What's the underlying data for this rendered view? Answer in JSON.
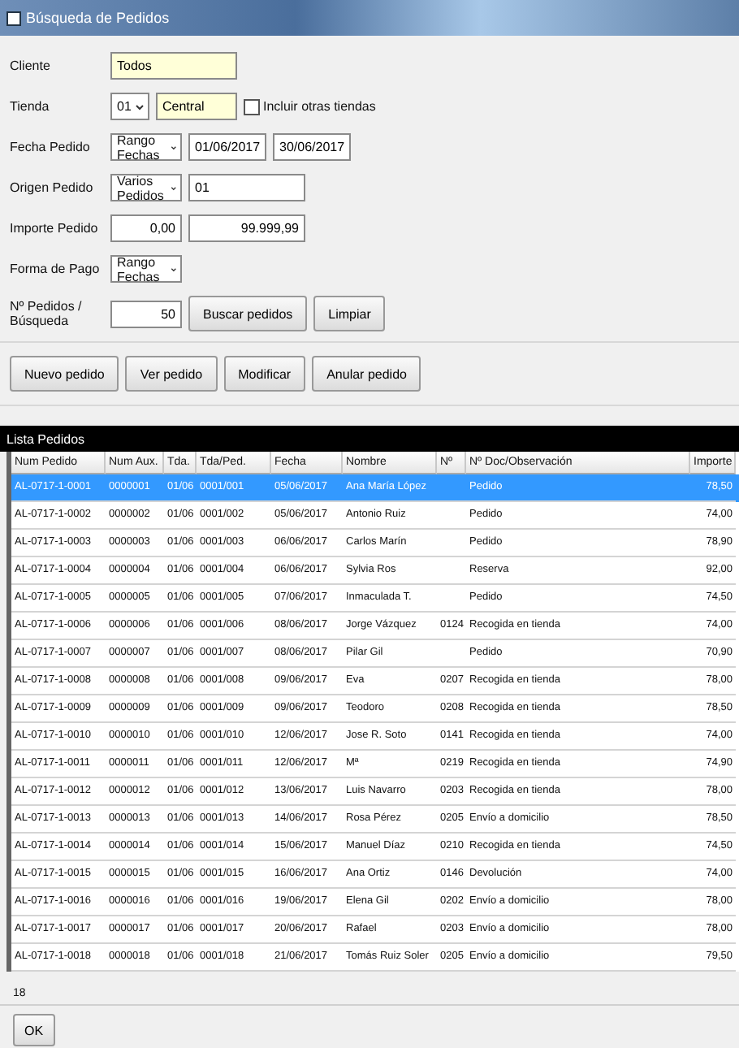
{
  "window": {
    "title": "Búsqueda de Pedidos"
  },
  "form": {
    "client": {
      "label": "Cliente",
      "value": "Todos"
    },
    "store": {
      "label": "Tienda",
      "code": "01",
      "value": "Central",
      "other_stores": {
        "label": "Incluir otras tiendas",
        "checked": false
      }
    },
    "date": {
      "label": "Fecha Pedido",
      "mode": "Rango Fechas",
      "from": "01/06/2017",
      "to": "30/06/2017"
    },
    "origin": {
      "label": "Origen Pedido",
      "mode": "Varios Pedidos",
      "value": "01"
    },
    "amount": {
      "label": "Importe Pedido",
      "from": "0,00",
      "to": "99.999,99"
    },
    "payment": {
      "label": "Forma de Pago",
      "mode": "Rango Fechas"
    },
    "count": {
      "label": "Nº Pedidos / Búsqueda",
      "value": "50"
    },
    "search_button": "Buscar pedidos",
    "clear_button": "Limpiar"
  },
  "actions": [
    "Nuevo pedido",
    "Ver pedido",
    "Modificar",
    "Anular pedido"
  ],
  "list": {
    "title": "Lista Pedidos",
    "columns": [
      "Num Pedido",
      "Num Aux.",
      "Tda.",
      "Tda/Ped.",
      "Fecha",
      "Nombre",
      "Nº",
      "Nº Doc/Observación",
      "Importe"
    ],
    "rows": [
      {
        "selected": true,
        "cells": [
          "AL-0717-1-0001",
          "0000001",
          "01/06",
          "0001/001",
          "05/06/2017",
          "Ana María López",
          "",
          "Pedido",
          "78,50"
        ]
      },
      {
        "selected": false,
        "cells": [
          "AL-0717-1-0002",
          "0000002",
          "01/06",
          "0001/002",
          "05/06/2017",
          "Antonio Ruiz",
          "",
          "Pedido",
          "74,00"
        ]
      },
      {
        "selected": false,
        "cells": [
          "AL-0717-1-0003",
          "0000003",
          "01/06",
          "0001/003",
          "06/06/2017",
          "Carlos Marín",
          "",
          "Pedido",
          "78,90"
        ]
      },
      {
        "selected": false,
        "cells": [
          "AL-0717-1-0004",
          "0000004",
          "01/06",
          "0001/004",
          "06/06/2017",
          "Sylvia Ros",
          "",
          "Reserva",
          "92,00"
        ]
      },
      {
        "selected": false,
        "cells": [
          "AL-0717-1-0005",
          "0000005",
          "01/06",
          "0001/005",
          "07/06/2017",
          "Inmaculada T.",
          "",
          "Pedido",
          "74,50"
        ]
      },
      {
        "selected": false,
        "cells": [
          "AL-0717-1-0006",
          "0000006",
          "01/06",
          "0001/006",
          "08/06/2017",
          "Jorge Vázquez",
          "0124",
          "Recogida en tienda",
          "74,00"
        ]
      },
      {
        "selected": false,
        "cells": [
          "AL-0717-1-0007",
          "0000007",
          "01/06",
          "0001/007",
          "08/06/2017",
          "Pilar Gil",
          "",
          "Pedido",
          "70,90"
        ]
      },
      {
        "selected": false,
        "cells": [
          "AL-0717-1-0008",
          "0000008",
          "01/06",
          "0001/008",
          "09/06/2017",
          "Eva",
          "0207",
          "Recogida en tienda",
          "78,00"
        ]
      },
      {
        "selected": false,
        "cells": [
          "AL-0717-1-0009",
          "0000009",
          "01/06",
          "0001/009",
          "09/06/2017",
          "Teodoro",
          "0208",
          "Recogida en tienda",
          "78,50"
        ]
      },
      {
        "selected": false,
        "cells": [
          "AL-0717-1-0010",
          "0000010",
          "01/06",
          "0001/010",
          "12/06/2017",
          "Jose R. Soto",
          "0141",
          "Recogida en tienda",
          "74,00"
        ]
      },
      {
        "selected": false,
        "cells": [
          "AL-0717-1-0011",
          "0000011",
          "01/06",
          "0001/011",
          "12/06/2017",
          "Mª",
          "0219",
          "Recogida en tienda",
          "74,90"
        ]
      },
      {
        "selected": false,
        "cells": [
          "AL-0717-1-0012",
          "0000012",
          "01/06",
          "0001/012",
          "13/06/2017",
          "Luis Navarro",
          "0203",
          "Recogida en tienda",
          "78,00"
        ]
      },
      {
        "selected": false,
        "cells": [
          "AL-0717-1-0013",
          "0000013",
          "01/06",
          "0001/013",
          "14/06/2017",
          "Rosa Pérez",
          "0205",
          "Envío a domicilio",
          "78,50"
        ]
      },
      {
        "selected": false,
        "cells": [
          "AL-0717-1-0014",
          "0000014",
          "01/06",
          "0001/014",
          "15/06/2017",
          "Manuel Díaz",
          "0210",
          "Recogida en tienda",
          "74,50"
        ]
      },
      {
        "selected": false,
        "cells": [
          "AL-0717-1-0015",
          "0000015",
          "01/06",
          "0001/015",
          "16/06/2017",
          "Ana Ortiz",
          "0146",
          "Devolución",
          "74,00"
        ]
      },
      {
        "selected": false,
        "cells": [
          "AL-0717-1-0016",
          "0000016",
          "01/06",
          "0001/016",
          "19/06/2017",
          "Elena Gil",
          "0202",
          "Envío a domicilio",
          "78,00"
        ]
      },
      {
        "selected": false,
        "cells": [
          "AL-0717-1-0017",
          "0000017",
          "01/06",
          "0001/017",
          "20/06/2017",
          "Rafael",
          "0203",
          "Envío a domicilio",
          "78,00"
        ]
      },
      {
        "selected": false,
        "cells": [
          "AL-0717-1-0018",
          "0000018",
          "01/06",
          "0001/018",
          "21/06/2017",
          "Tomás Ruiz Soler",
          "0205",
          "Envío a domicilio",
          "79,50"
        ]
      }
    ]
  },
  "status": "18",
  "ok_button": "OK"
}
